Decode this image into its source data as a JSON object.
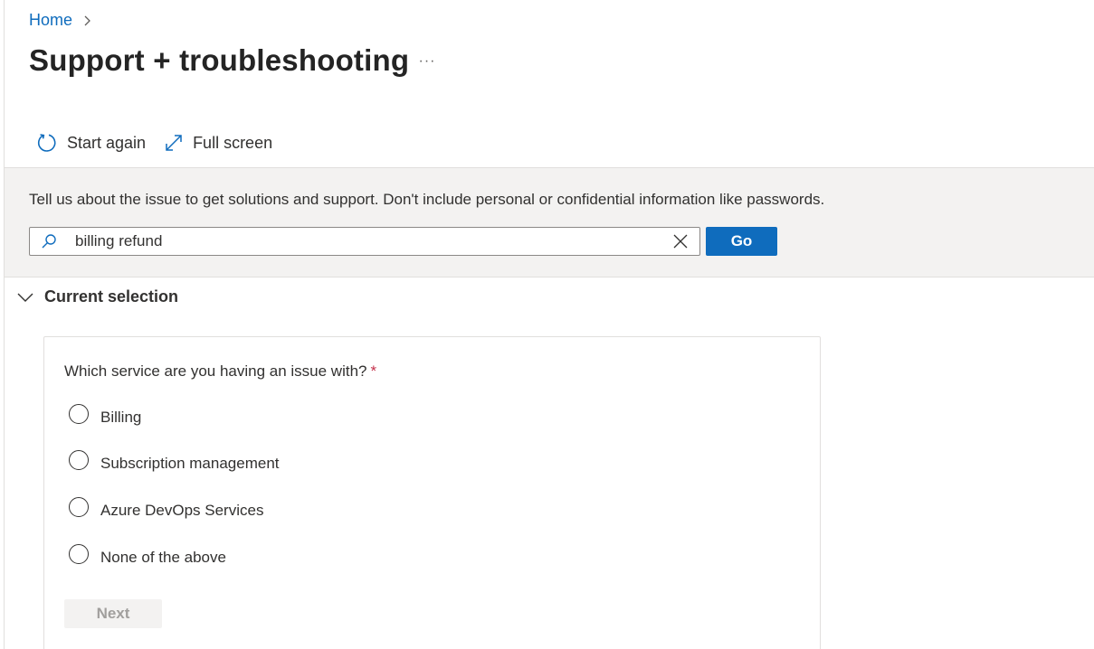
{
  "breadcrumb": {
    "home_label": "Home",
    "separator_icon": "chevron-right-icon"
  },
  "header": {
    "title": "Support + troubleshooting",
    "more_label": "···"
  },
  "toolbar": {
    "start_again_label": "Start again",
    "start_again_icon": "refresh-icon",
    "full_screen_label": "Full screen",
    "full_screen_icon": "expand-icon"
  },
  "issue": {
    "instruction": "Tell us about the issue to get solutions and support. Don't include personal or confidential information like passwords.",
    "search_value": "billing refund",
    "go_label": "Go"
  },
  "current_selection": {
    "header": "Current selection",
    "question": "Which service are you having an issue with?",
    "required_mark": "*",
    "options": [
      {
        "label": "Billing",
        "selected": false
      },
      {
        "label": "Subscription management",
        "selected": false
      },
      {
        "label": "Azure DevOps Services",
        "selected": false
      },
      {
        "label": "None of the above",
        "selected": false
      }
    ],
    "next_label": "Next"
  },
  "colors": {
    "accent": "#0f6cbd",
    "band": "#f3f2f1",
    "required": "#c4314b"
  }
}
